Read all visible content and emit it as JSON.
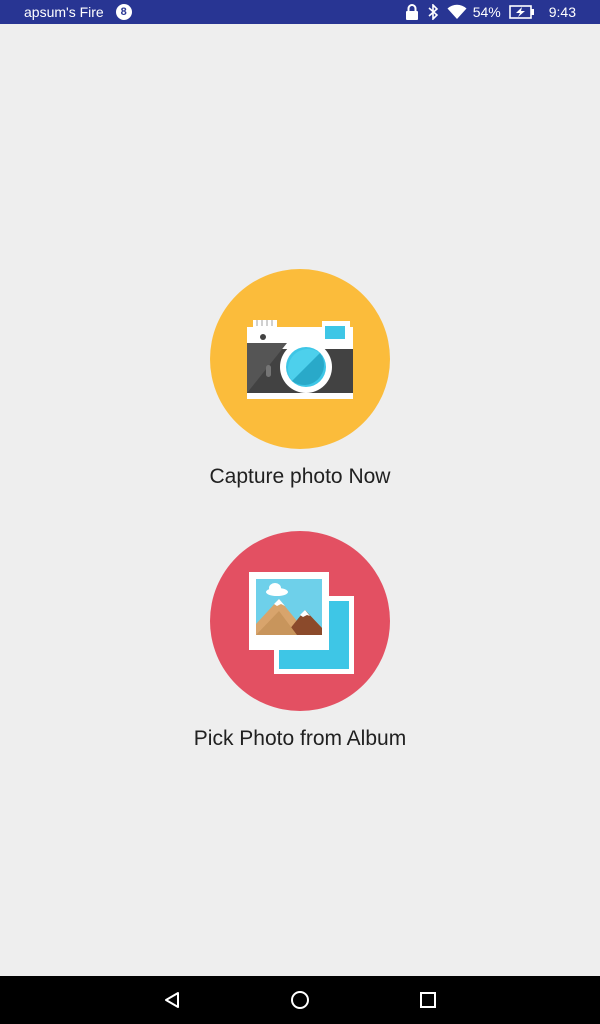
{
  "status_bar": {
    "device_name": "apsum's Fire",
    "notification_count": "8",
    "battery_percent": "54%",
    "time": "9:43",
    "icons": [
      "lock-icon",
      "bluetooth-icon",
      "wifi-icon",
      "battery-charging-icon"
    ]
  },
  "actions": {
    "capture": {
      "label": "Capture photo Now",
      "icon": "camera-icon",
      "circle_color": "#fbbc3b"
    },
    "album": {
      "label": "Pick Photo from Album",
      "icon": "photo-album-icon",
      "circle_color": "#e35062"
    }
  },
  "nav_bar": {
    "buttons": [
      "back-icon",
      "home-icon",
      "recents-icon"
    ]
  }
}
